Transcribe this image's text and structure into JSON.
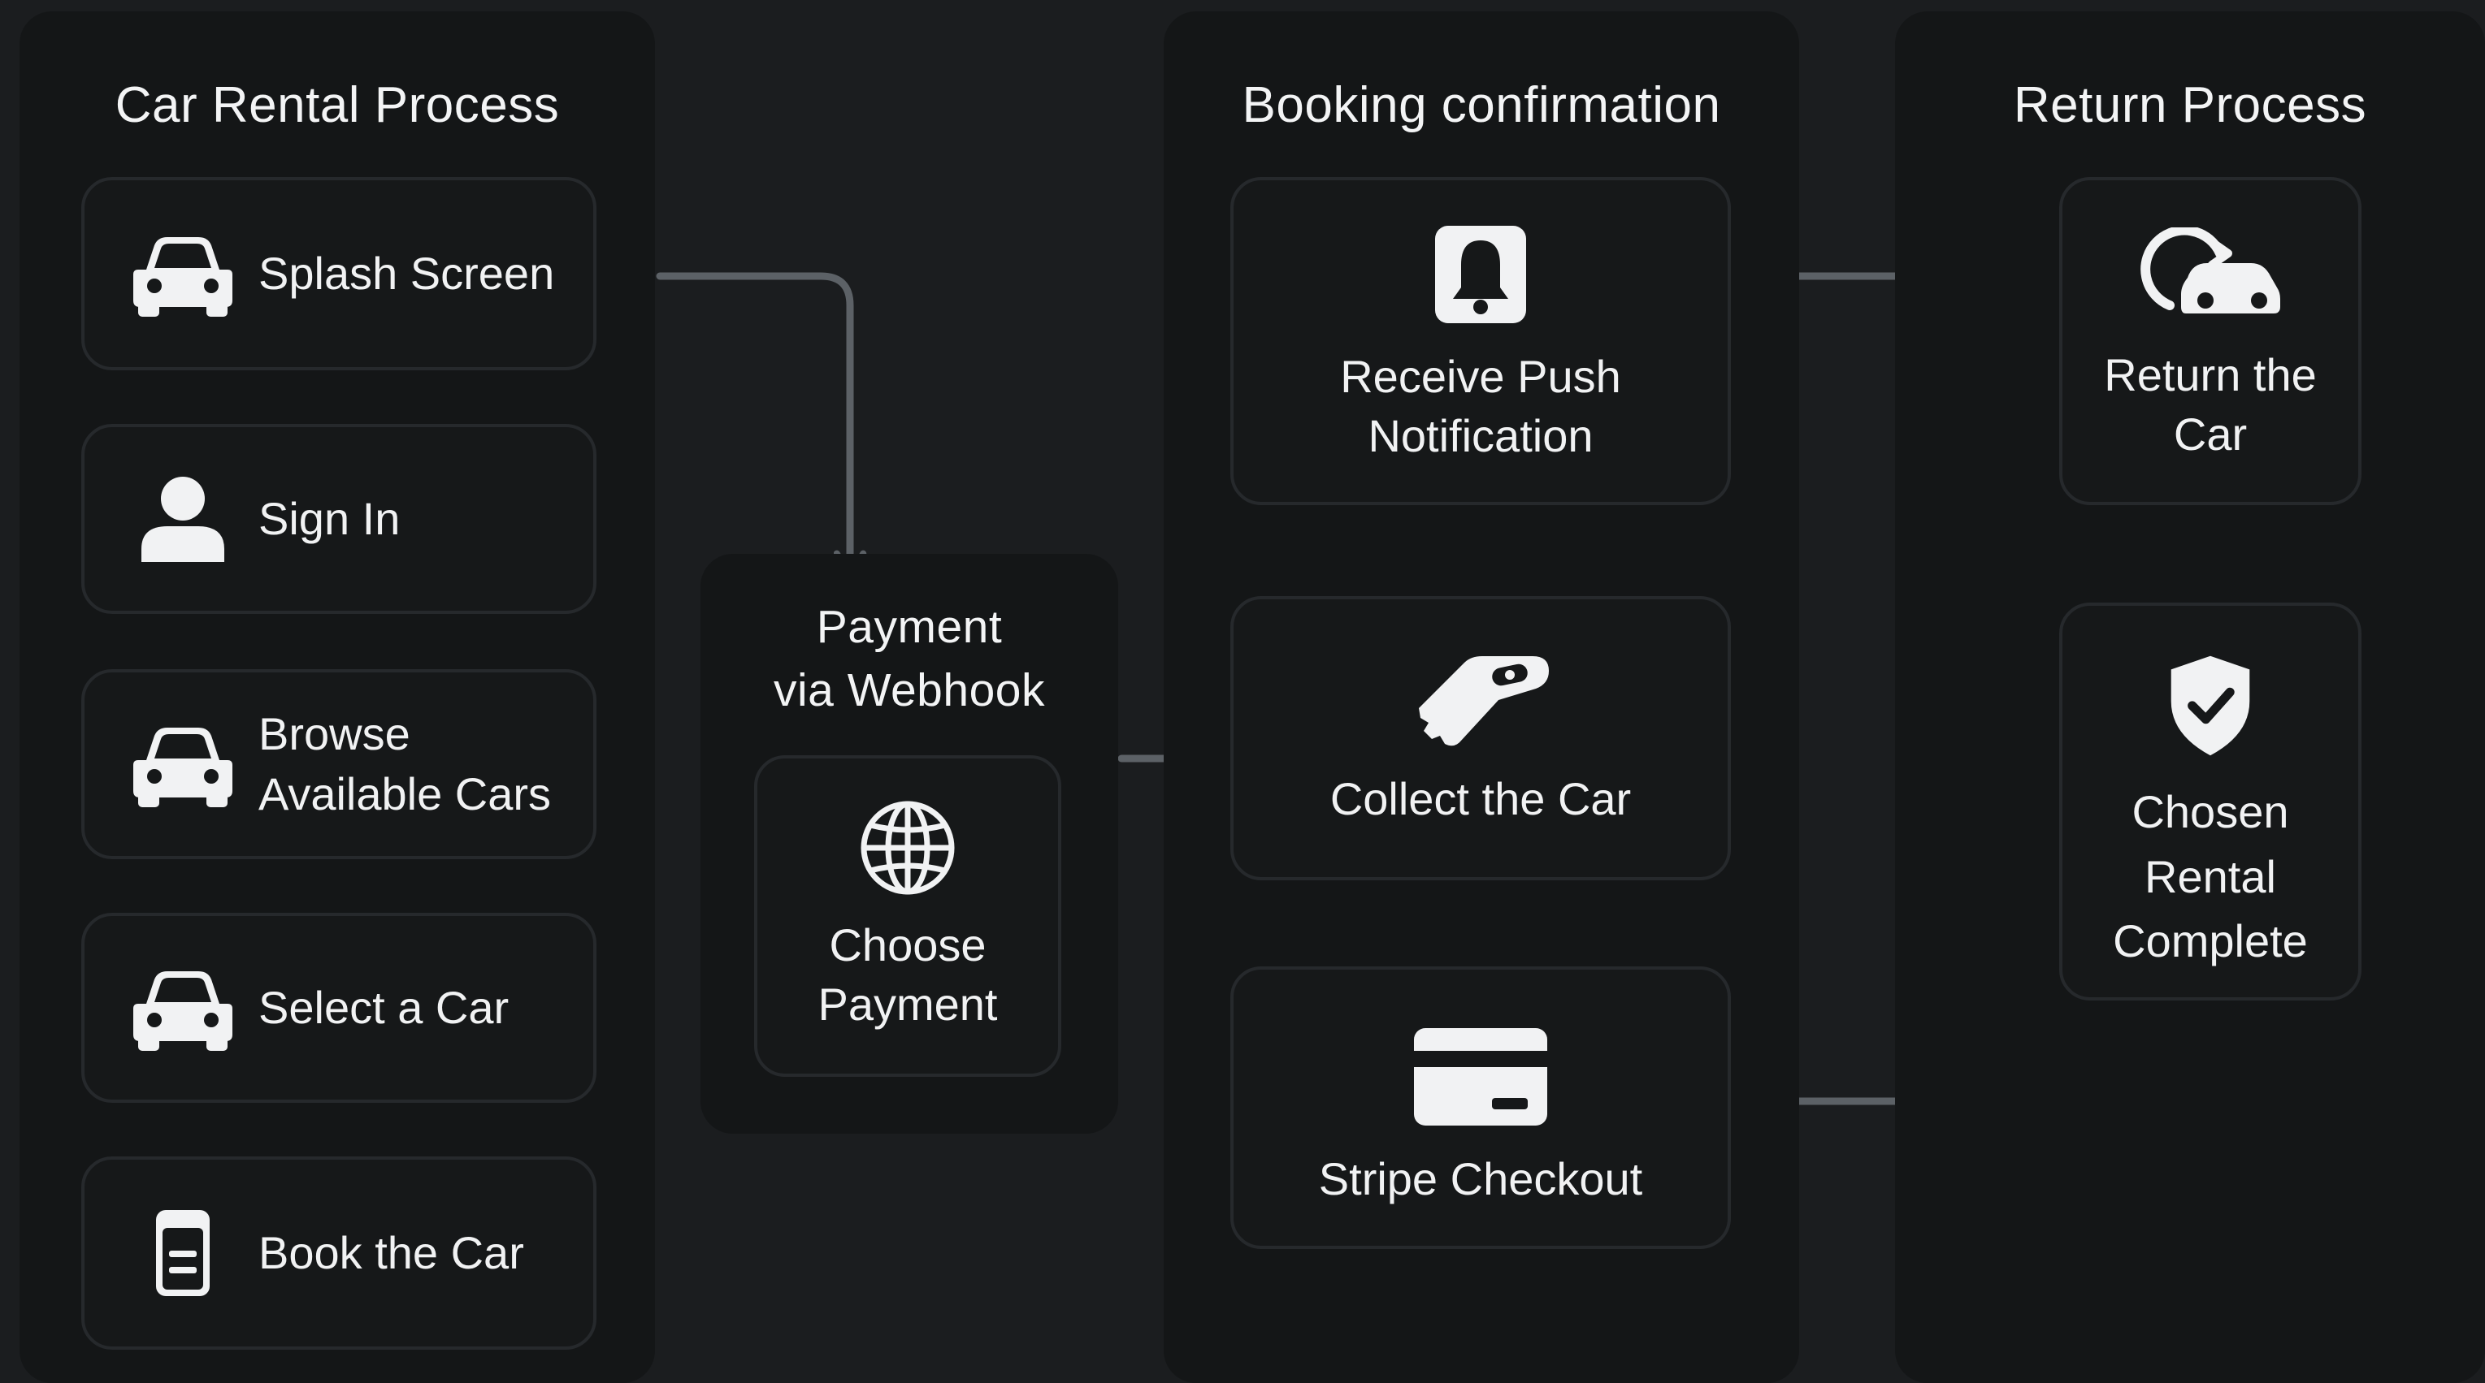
{
  "colors": {
    "background": "#1b1d1f",
    "panel": "#141617",
    "card": "#161819",
    "card_border": "#26292c",
    "text": "#f1f2f3",
    "connector": "#5c6166"
  },
  "panels": {
    "rental": {
      "title": "Car Rental Process",
      "steps": [
        {
          "label": "Splash Screen",
          "icon": "car-icon"
        },
        {
          "label": "Sign In",
          "icon": "user-icon"
        },
        {
          "label": "Browse\nAvailable Cars",
          "icon": "car-icon"
        },
        {
          "label": "Select a Car",
          "icon": "car-icon"
        },
        {
          "label": "Book the Car",
          "icon": "document-icon"
        }
      ]
    },
    "payment": {
      "title": "Payment\nvia Webhook",
      "steps": [
        {
          "label": "Choose\nPayment",
          "icon": "globe-icon"
        }
      ]
    },
    "booking": {
      "title": "Booking confirmation",
      "steps": [
        {
          "label": "Receive Push\nNotification",
          "icon": "bell-icon"
        },
        {
          "label": "Collect the Car",
          "icon": "key-icon"
        },
        {
          "label": "Stripe Checkout",
          "icon": "credit-card-icon"
        }
      ]
    },
    "return": {
      "title": "Return Process",
      "steps": [
        {
          "label": "Return the\nCar",
          "icon": "car-return-icon"
        },
        {
          "label": "Chosen\nRental\nComplete",
          "icon": "shield-check-icon"
        }
      ]
    }
  }
}
